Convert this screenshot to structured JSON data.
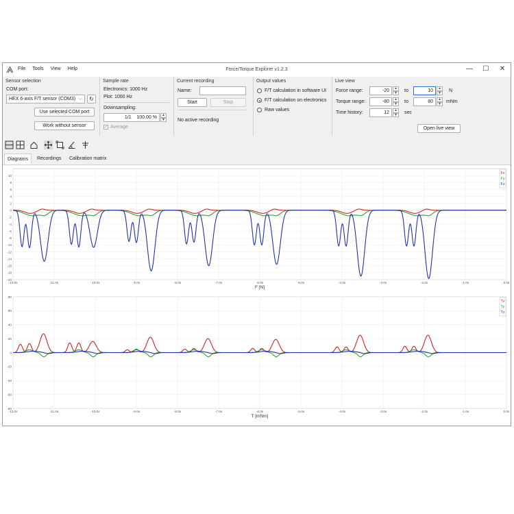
{
  "window": {
    "title": "Force/Torque Explorer v1.2.3",
    "menu": [
      "File",
      "Tools",
      "View",
      "Help"
    ],
    "controls": {
      "minimize": "—",
      "maximize": "☐",
      "close": "✕"
    }
  },
  "sensor_selection": {
    "title": "Sensor selection",
    "com_port_label": "COM port:",
    "com_port_value": "HEX 6-axis F/T sensor (COM3)",
    "use_button": "Use selected COM port",
    "work_without_button": "Work without sensor"
  },
  "sample_rate": {
    "title": "Sample rate",
    "electronics": "Electronics: 1000 Hz",
    "plot": "Plot: 1000 Hz",
    "downsampling_label": "Downsampling:",
    "downsampling_ratio": "1/1",
    "downsampling_percent": "100.00 %",
    "average_label": "Average",
    "average_checked": true
  },
  "current_recording": {
    "title": "Current recording",
    "name_label": "Name:",
    "name_value": "",
    "start_button": "Start",
    "stop_button": "Stop",
    "status": "No active recording"
  },
  "output_values": {
    "title": "Output values",
    "options": [
      {
        "label": "F/T calculation in software UI",
        "selected": false
      },
      {
        "label": "F/T calculation on electronics",
        "selected": true
      },
      {
        "label": "Raw values",
        "selected": false
      }
    ]
  },
  "live_view": {
    "title": "Live view",
    "force_label": "Force range:",
    "force_from": "-20",
    "force_to": "10",
    "force_unit": "N",
    "torque_label": "Torque range:",
    "torque_from": "-80",
    "torque_to": "80",
    "torque_unit": "mNm",
    "time_label": "Time history:",
    "time_value": "12",
    "time_unit": "sec",
    "to_label": "to",
    "open_button": "Open live view"
  },
  "tabs": [
    {
      "label": "Diagrams",
      "active": true
    },
    {
      "label": "Recordings",
      "active": false
    },
    {
      "label": "Calibration matrix",
      "active": false
    }
  ],
  "colors": {
    "x": "#d62020",
    "y": "#2ca02c",
    "z": "#1f2fb8"
  },
  "chart_data": [
    {
      "type": "line",
      "xlabel": "F [N]",
      "xlim": [
        -12,
        0
      ],
      "ylim": [
        -20,
        12
      ],
      "yticks": [
        10,
        8,
        6,
        4,
        2,
        0,
        -2,
        -4,
        -6,
        -8,
        -10,
        -12,
        -14,
        -16,
        -18,
        -20
      ],
      "xticks": [
        -12,
        -11,
        -10,
        -9,
        -8,
        -7,
        -6,
        -5,
        -4,
        -3,
        -2,
        -1,
        0
      ],
      "xtick_labels": [
        "-12.0s",
        "-11.0s",
        "-10.0s",
        "-9.0s",
        "-8.0s",
        "-7.0s",
        "-6.0s",
        "-5.0s",
        "-4.0s",
        "-3.0s",
        "-2.0s",
        "-1.0s",
        "0.0s"
      ],
      "legend": [
        "Fx",
        "Fy",
        "Fz"
      ],
      "grid": true,
      "events": [
        {
          "t": -11.6,
          "p": [
            -10.5,
            -10.8,
            -14.7
          ]
        },
        {
          "t": -10.4,
          "p": [
            -9.8,
            -10.6,
            -10.7
          ]
        },
        {
          "t": -9.0,
          "p": [
            -9.0,
            -9.3,
            -17.5
          ]
        },
        {
          "t": -7.6,
          "p": [
            -9.7,
            -9.2,
            -16.0
          ]
        },
        {
          "t": -5.95,
          "p": [
            -10.0,
            -10.0,
            -15.6
          ]
        },
        {
          "t": -3.9,
          "p": [
            -10.3,
            -10.3,
            -19.0
          ]
        },
        {
          "t": -2.25,
          "p": [
            -10.3,
            -10.3,
            -19.7
          ]
        }
      ]
    },
    {
      "type": "line",
      "xlabel": "T [mNm]",
      "xlim": [
        -12,
        0
      ],
      "ylim": [
        -80,
        80
      ],
      "yticks": [
        80,
        60,
        40,
        20,
        0,
        -20,
        -40,
        -60,
        -80
      ],
      "xticks": [
        -12,
        -11,
        -10,
        -9,
        -8,
        -7,
        -6,
        -5,
        -4,
        -3,
        -2,
        -1,
        0
      ],
      "xtick_labels": [
        "-12.0s",
        "-11.0s",
        "-10.0s",
        "-9.0s",
        "-8.0s",
        "-7.0s",
        "-6.0s",
        "-5.0s",
        "-4.0s",
        "-3.0s",
        "-2.0s",
        "-1.0s",
        "0.0s"
      ],
      "legend": [
        "Tx",
        "Ty",
        "Tz"
      ],
      "grid": true,
      "events": [
        {
          "t": -11.6,
          "p": [
            12,
            13,
            27
          ]
        },
        {
          "t": -10.4,
          "p": [
            14,
            14,
            16
          ]
        },
        {
          "t": -9.0,
          "p": [
            4,
            5,
            22
          ]
        },
        {
          "t": -7.6,
          "p": [
            5,
            6,
            20
          ]
        },
        {
          "t": -5.95,
          "p": [
            6,
            6,
            19
          ]
        },
        {
          "t": -3.9,
          "p": [
            8,
            8,
            25
          ]
        },
        {
          "t": -2.25,
          "p": [
            9,
            9,
            25
          ]
        }
      ]
    }
  ]
}
